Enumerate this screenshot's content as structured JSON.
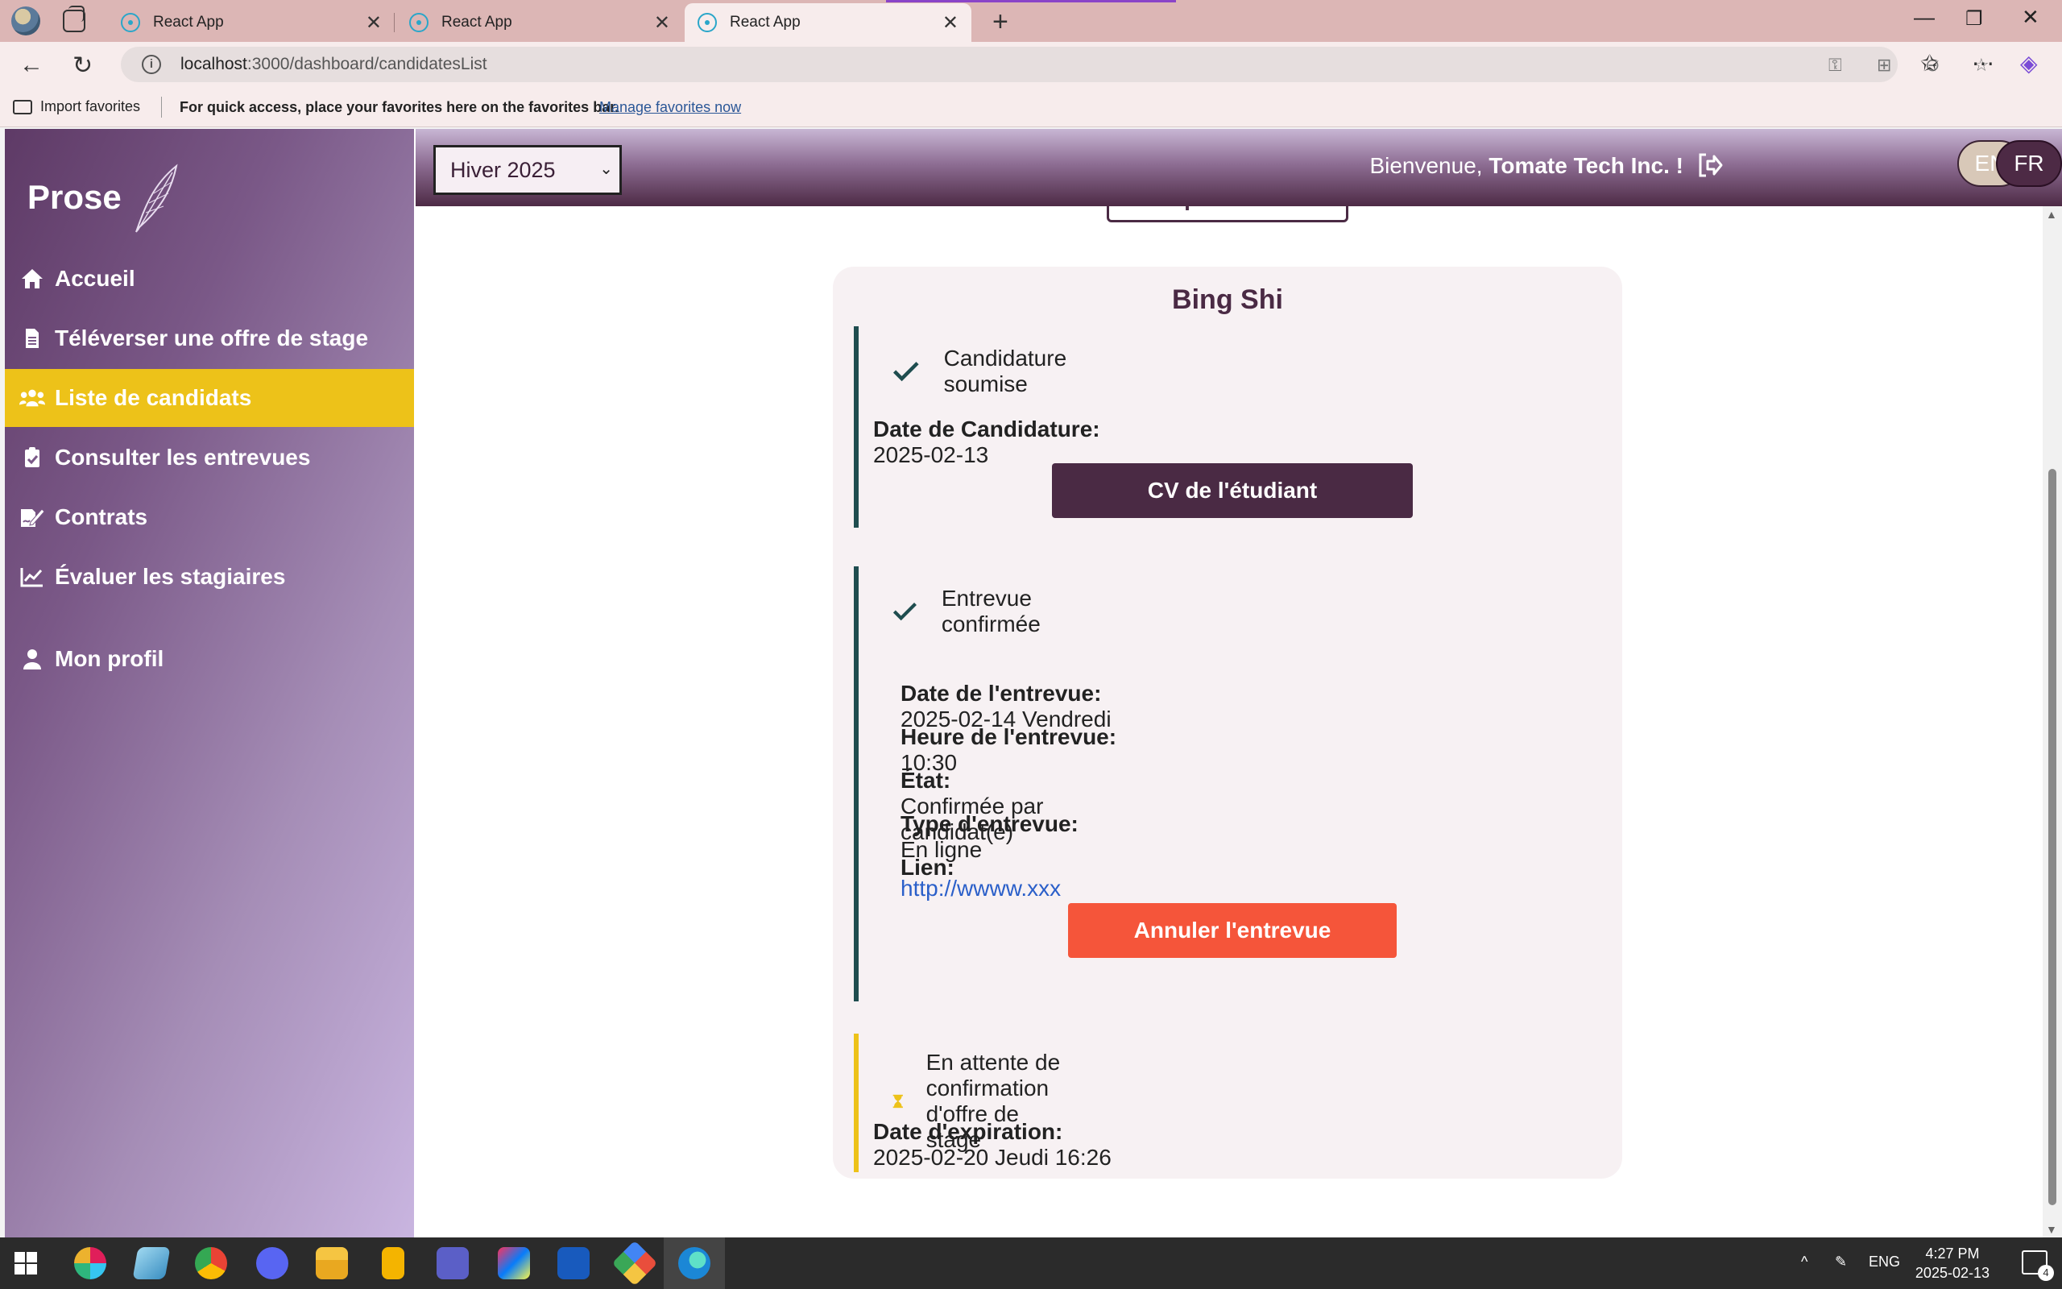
{
  "browser": {
    "tabs": [
      {
        "title": "React App"
      },
      {
        "title": "React App"
      },
      {
        "title": "React App"
      }
    ],
    "url_host": "localhost",
    "url_path": ":3000/dashboard/candidatesList",
    "favorites": {
      "import_label": "Import favorites",
      "hint": "For quick access, place your favorites here on the favorites bar.",
      "manage_link": "Manage favorites now"
    }
  },
  "sidebar": {
    "brand": "Prose",
    "items": [
      {
        "label": "Accueil",
        "icon": "home-icon"
      },
      {
        "label": "Téléverser une offre de stage",
        "icon": "document-icon"
      },
      {
        "label": "Liste de candidats",
        "icon": "users-icon",
        "active": true
      },
      {
        "label": "Consulter les entrevues",
        "icon": "clipboard-check-icon"
      },
      {
        "label": "Contrats",
        "icon": "signature-icon"
      },
      {
        "label": "Évaluer les stagiaires",
        "icon": "chart-line-icon"
      },
      {
        "label": "Mon profil",
        "icon": "user-icon"
      }
    ]
  },
  "topbar": {
    "session_select": "Hiver 2025",
    "welcome_prefix": "Bienvenue,",
    "company": "Tomate Tech Inc. !",
    "lang_en": "EN",
    "lang_fr": "FR"
  },
  "content": {
    "offer_button": "Description de l'offre",
    "candidate_name": "Bing Shi",
    "application": {
      "status": "Candidature soumise",
      "date_label": "Date de Candidature:",
      "date_value": "2025-02-13",
      "cv_button": "CV de l'étudiant"
    },
    "interview": {
      "status": "Entrevue confirmée",
      "date_label": "Date de l'entrevue:",
      "date_value": "2025-02-14 Vendredi",
      "time_label": "Heure de l'entrevue:",
      "time_value": "10:30",
      "state_label": "État:",
      "state_value": "Confirmée par candidat(e)",
      "type_label": "Type d'entrevue:",
      "type_value": "En ligne",
      "link_label": "Lien:",
      "link_value": "http://wwww.xxx",
      "cancel_button": "Annuler l'entrevue"
    },
    "offer_pending": {
      "status": "En attente de confirmation d'offre de stage",
      "expiry_label": "Date d'expiration:",
      "expiry_value": "2025-02-20 Jeudi 16:26"
    }
  },
  "taskbar": {
    "lang": "ENG",
    "time": "4:27 PM",
    "date": "2025-02-13",
    "notifications": "4"
  },
  "colors": {
    "accent_yellow": "#edc219",
    "brand_dark": "#4a2a44",
    "cancel_red": "#f5553a",
    "step_line": "#1f4d4f"
  }
}
